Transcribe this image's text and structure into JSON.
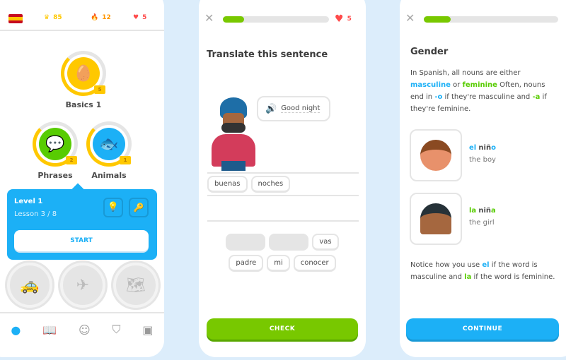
{
  "colors": {
    "accent": "#1cb0f6",
    "green": "#58cc02",
    "gold": "#ffc800",
    "heart": "#ff4b4b"
  },
  "home": {
    "stats": {
      "flag": "spain-flag-icon",
      "crowns": "85",
      "streak": "12",
      "hearts": "5"
    },
    "skills": [
      {
        "name": "Basics 1",
        "level": "5",
        "icon": "egg-icon"
      },
      {
        "name": "Phrases",
        "level": "2",
        "icon": "speech-bubbles-icon"
      },
      {
        "name": "Animals",
        "level": "1",
        "icon": "fish-icon"
      }
    ],
    "popup": {
      "title": "Level 1",
      "subtitle": "Lesson 3 / 8",
      "start": "START"
    },
    "locked": [
      "taxi-icon",
      "airplane-icon",
      "map-icon"
    ],
    "nav": [
      "learn-icon",
      "stories-icon",
      "profile-icon",
      "league-icon",
      "shop-icon"
    ]
  },
  "lesson": {
    "progress_pct": 20,
    "hearts": "5",
    "title": "Translate this sentence",
    "prompt": "Good night",
    "answer": [
      "buenas",
      "noches"
    ],
    "bank_row1": [
      "vas"
    ],
    "bank_row2": [
      "padre",
      "mi",
      "conocer"
    ],
    "check": "CHECK"
  },
  "tips": {
    "progress_pct": 20,
    "title": "Gender",
    "p1": [
      "In Spanish, all nouns are either ",
      "masculine",
      " or ",
      "feminine",
      "  Often, nouns end in ",
      "-o",
      " if they're masculine and ",
      "-a",
      " if they're feminine."
    ],
    "ex1": {
      "article": "el",
      "stem": "niñ",
      "ending": "o",
      "meaning": "the boy"
    },
    "ex2": {
      "article": "la",
      "stem": "niñ",
      "ending": "a",
      "meaning": "the girl"
    },
    "p2": [
      "Notice how you use ",
      "el",
      " if the word is masculine and ",
      "la",
      " if the word is feminine."
    ],
    "continue": "CONTINUE"
  }
}
